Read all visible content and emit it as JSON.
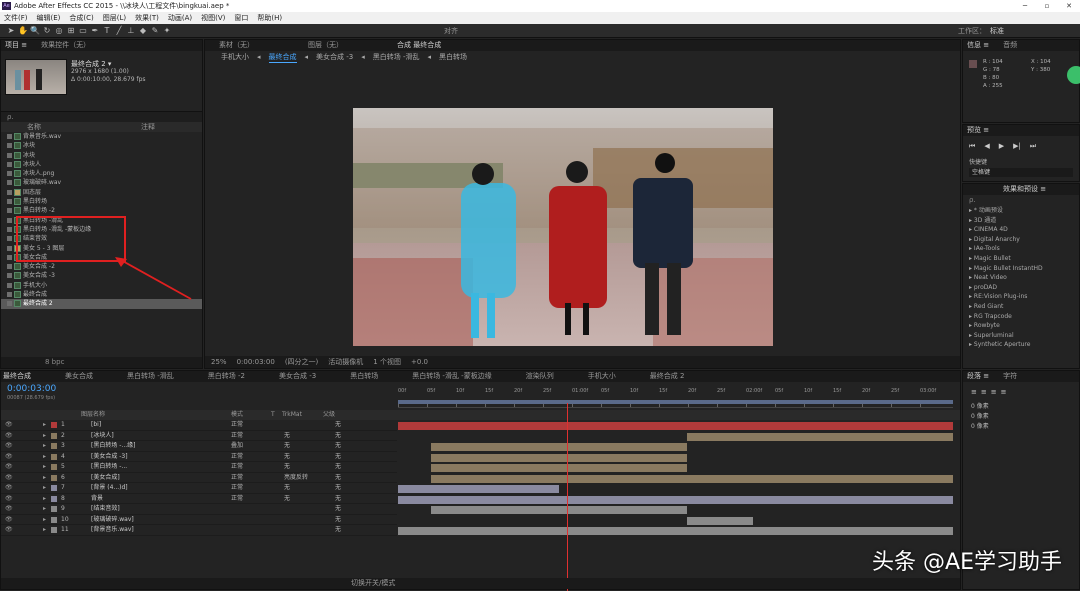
{
  "window": {
    "title": "Adobe After Effects CC 2015 - \\\\冰块人\\工程文件\\bingkuai.aep *",
    "minimize": "─",
    "maximize": "▫",
    "close": "✕"
  },
  "menu": [
    "文件(F)",
    "编辑(E)",
    "合成(C)",
    "图层(L)",
    "效果(T)",
    "动画(A)",
    "视图(V)",
    "窗口",
    "帮助(H)"
  ],
  "toolbar": {
    "snap_label": "对齐",
    "workspace_label": "工作区：",
    "workspace_value": "标准",
    "search_placeholder": "搜索帮助"
  },
  "project": {
    "tab_project": "项目 ≡",
    "tab_effects_ctrl": "效果控件（无）",
    "comp_name": "最终合成 2 ▾",
    "comp_info_1": "2976 x 1680 (1.00)",
    "comp_info_2": "Δ 0:00:10:00, 28.679 fps",
    "col_name": "名称",
    "col_comment": "注释",
    "items": [
      {
        "name": "背景音乐.wav",
        "type": "file"
      },
      {
        "name": "冰块",
        "type": "file"
      },
      {
        "name": "冰块",
        "type": "file"
      },
      {
        "name": "冰块人",
        "type": "file"
      },
      {
        "name": "冰块人.png",
        "type": "file"
      },
      {
        "name": "玻璃破碎.wav",
        "type": "file"
      },
      {
        "name": "固态层",
        "type": "folder"
      },
      {
        "name": "黑白转场",
        "type": "file"
      },
      {
        "name": "黑白转场 -2",
        "type": "file"
      },
      {
        "name": "黑白转场 -滑乱",
        "type": "file"
      },
      {
        "name": "黑白转场 -滑乱 -蒙板边缘",
        "type": "file"
      },
      {
        "name": "结束音效",
        "type": "file"
      },
      {
        "name": "美女 5 - 3 图层",
        "type": "folder"
      },
      {
        "name": "美女合成",
        "type": "file"
      },
      {
        "name": "美女合成 -2",
        "type": "file"
      },
      {
        "name": "美女合成 -3",
        "type": "file"
      },
      {
        "name": "手机大小",
        "type": "file"
      },
      {
        "name": "最终合成",
        "type": "file"
      },
      {
        "name": "最终合成 2",
        "type": "file",
        "selected": true
      }
    ],
    "bpc": "8 bpc"
  },
  "viewer": {
    "tabs_top": [
      "素材（无）",
      "图层（无）",
      "合成 最终合成"
    ],
    "flow": [
      "手机大小",
      "最终合成",
      "美女合成 -3",
      "黑白转场 -滑乱",
      "黑白转场"
    ],
    "flow_selected": 1,
    "zoom": "25%",
    "timecode": "0:00:03:00",
    "resolution": "(四分之一)",
    "camera": "活动摄像机",
    "views": "1 个视图",
    "exposure": "+0.0"
  },
  "info_panel": {
    "tab_info": "信息 ≡",
    "tab_audio": "音频",
    "r": "R : 104",
    "g": "G : 78",
    "b": "B : 80",
    "a": "A : 255",
    "x": "X : 104",
    "y": "Y : 380"
  },
  "preview_panel": {
    "tab": "预览 ≡",
    "shortcut_label": "快捷键",
    "shortcut_value": "空格键"
  },
  "effects_panel": {
    "tab": "效果和预设 ≡",
    "search_placeholder": "ρ.",
    "items": [
      "* 动画预设",
      "3D 通道",
      "CINEMA 4D",
      "Digital Anarchy",
      "IAe-Tools",
      "Magic Bullet",
      "Magic Bullet InstantHD",
      "Neat Video",
      "proDAD",
      "RE:Vision Plug-ins",
      "Red Giant",
      "RG Trapcode",
      "Rowbyte",
      "Superluminal",
      "Synthetic Aperture"
    ]
  },
  "paragraph_panel": {
    "tab_para": "段落 ≡",
    "tab_char": "字符",
    "px1": "0 像素",
    "px2": "0 像素",
    "px3": "0 像素",
    "px4": "0 像素",
    "px5": "0 像素"
  },
  "timeline": {
    "tabs": [
      "最终合成",
      "美女合成",
      "黑白转场 -滑乱",
      "黑白转场 -2",
      "美女合成 -3",
      "黑白转场",
      "黑白转场 -滑乱 -蒙板边缘",
      "渲染队列",
      "手机大小",
      "最终合成 2"
    ],
    "timecode": "0:00:03:00",
    "frames": "00087 (28.679 fps)",
    "col_source": "图层名称",
    "col_mode": "模式",
    "col_t": "T",
    "col_trkmat": "TrkMat",
    "col_parent": "父级",
    "ruler": [
      "00f",
      "05f",
      "10f",
      "15f",
      "20f",
      "25f",
      "01:00f",
      "05f",
      "10f",
      "15f",
      "20f",
      "25f",
      "02:00f",
      "05f",
      "10f",
      "15f",
      "20f",
      "25f",
      "03:00f"
    ],
    "layers": [
      {
        "num": "1",
        "name": "[bi]",
        "mode": "正常",
        "trk": "",
        "parent": "无",
        "color": "#b13a3a"
      },
      {
        "num": "2",
        "name": "[冰块人]",
        "mode": "正常",
        "trk": "无",
        "parent": "无",
        "color": "#8a7a60"
      },
      {
        "num": "3",
        "name": "[黑白转场 -...缘]",
        "mode": "叠加",
        "trk": "无",
        "parent": "无",
        "color": "#8a7a60"
      },
      {
        "num": "4",
        "name": "[美女合成 -3]",
        "mode": "正常",
        "trk": "无",
        "parent": "无",
        "color": "#8a7a60"
      },
      {
        "num": "5",
        "name": "[黑白转场 -...",
        "mode": "正常",
        "trk": "无",
        "parent": "无",
        "color": "#8a7a60"
      },
      {
        "num": "6",
        "name": "[美女合成]",
        "mode": "正常",
        "trk": "亮度反转",
        "parent": "无",
        "color": "#8a7a60"
      },
      {
        "num": "7",
        "name": "[背景 (4...)d]",
        "mode": "正常",
        "trk": "无",
        "parent": "无",
        "color": "#8a8aa0"
      },
      {
        "num": "8",
        "name": "背景",
        "mode": "正常",
        "trk": "无",
        "parent": "无",
        "color": "#8a8aa0"
      },
      {
        "num": "9",
        "name": "[结束音效]",
        "mode": "",
        "trk": "",
        "parent": "无",
        "color": "#8a8a8a"
      },
      {
        "num": "10",
        "name": "[玻璃破碎.wav]",
        "mode": "",
        "trk": "",
        "parent": "无",
        "color": "#8a8a8a"
      },
      {
        "num": "11",
        "name": "[背景音乐.wav]",
        "mode": "",
        "trk": "",
        "parent": "无",
        "color": "#8a8a8a"
      }
    ],
    "toggle_label": "切换开关/模式"
  },
  "watermark": "头条 @AE学习助手",
  "colors": {
    "accent": "#4aa8ff",
    "playhead": "#e03030",
    "highlight": "#e02020"
  }
}
